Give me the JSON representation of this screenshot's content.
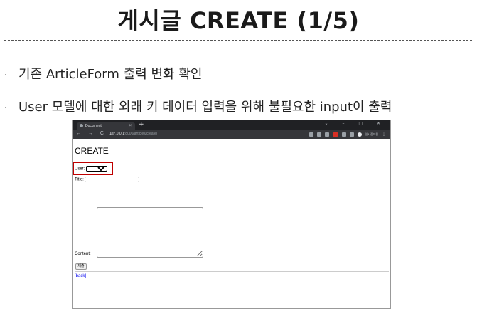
{
  "slide": {
    "title": "게시글 CREATE (1/5)",
    "bullets": [
      "기존 ArticleForm 출력 변화 확인",
      "User 모델에 대한 외래 키 데이터 입력을 위해 불필요한 input이 출력"
    ],
    "bullet_symbol": "·"
  },
  "browser": {
    "tab_title": "Document",
    "tab_close": "×",
    "new_tab": "+",
    "window_controls": "⌄ – ▢ ✕",
    "nav_buttons": "← → C ⌂",
    "url_host": "127.0.0.1",
    "url_path": ":8000/articles/create/",
    "profile_label": "일시중지됨"
  },
  "page": {
    "heading": "CREATE",
    "user_label": "User:",
    "user_selected": "---------",
    "title_label": "Title:",
    "title_value": "",
    "content_label": "Content:",
    "submit_label": "제출",
    "back_link": "[back]",
    "highlight_color": "#c00000"
  }
}
